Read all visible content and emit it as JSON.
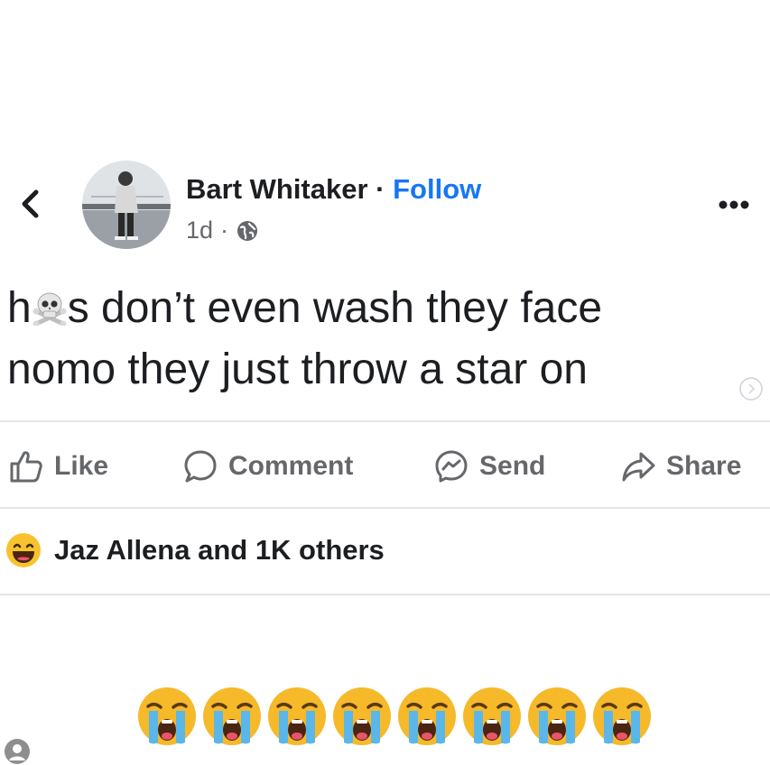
{
  "post": {
    "author": "Bart Whitaker",
    "separator": "·",
    "follow_label": "Follow",
    "time": "1d",
    "meta_dot": "·",
    "text_line1_a": "h",
    "text_line1_b": "s don’t even wash they face",
    "text_line2": "nomo they just throw a star on"
  },
  "actions": {
    "like": "Like",
    "comment": "Comment",
    "send": "Send",
    "share": "Share"
  },
  "reactions": {
    "summary": "Jaz Allena and 1K others"
  },
  "caption": {
    "emoji_count": 8
  },
  "icons": {
    "back": "chevron-left-icon",
    "more": "more-dots-icon",
    "globe": "globe-icon",
    "skull": "skull-crossbones-icon",
    "like": "thumbs-up-icon",
    "comment": "speech-bubble-icon",
    "send": "messenger-icon",
    "share": "share-arrow-icon",
    "reaction": "laughing-face-icon",
    "caption": "loudly-crying-face-icon"
  },
  "colors": {
    "accent": "#1877f2",
    "secondary_text": "#65676b",
    "primary_text": "#1c1e21",
    "divider": "#e4e6eb",
    "emoji_yellow": "#f7c22e"
  }
}
